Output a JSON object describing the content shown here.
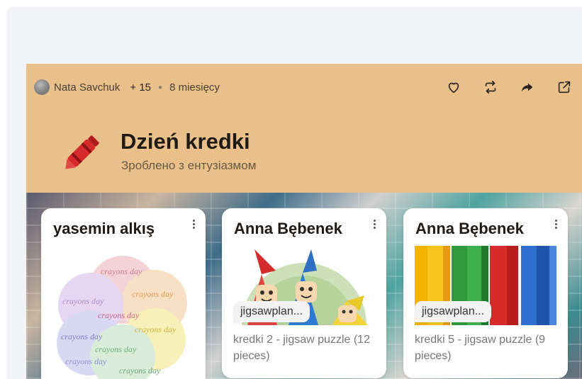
{
  "post": {
    "author": "Nata Savchuk",
    "contributors": "+ 15",
    "time": "8 miesięcy",
    "title": "Dzień kredki",
    "subtitle": "Зроблено з ентузіазмом",
    "header_color": "#e9c08a",
    "icons": [
      "heart-icon",
      "repost-icon",
      "share-icon",
      "open-external-icon"
    ]
  },
  "cards": [
    {
      "author": "yasemin alkış",
      "image": "word-cloud",
      "word": "crayons day"
    },
    {
      "author": "Anna Bębenek",
      "source": "jigsawplan...",
      "description": "kredki 2 - jigsaw puzzle (12 pieces)"
    },
    {
      "author": "Anna Bębenek",
      "source": "jigsawplan...",
      "description": "kredki 5 - jigsaw puzzle (9 pieces)"
    }
  ]
}
